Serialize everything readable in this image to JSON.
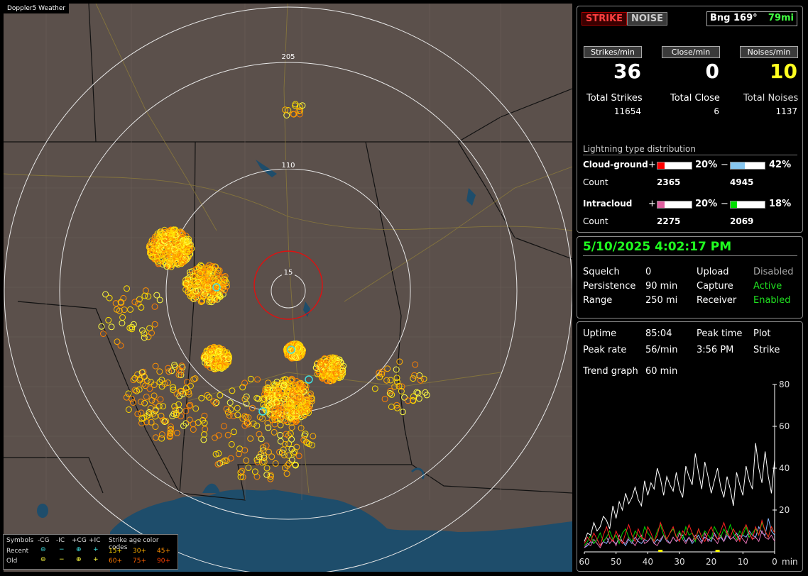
{
  "window_title": "Doppler5 Weather",
  "map": {
    "ring_labels": [
      "205",
      "110",
      "15"
    ],
    "legend": {
      "symbols_label": "Symbols",
      "cols": [
        "-CG",
        "-IC",
        "+CG",
        "+IC"
      ],
      "rows": [
        "Recent",
        "Old"
      ],
      "age_title": "Strike age color codes",
      "age_codes": [
        "15+",
        "30+",
        "45+",
        "60+",
        "75+",
        "90+"
      ],
      "age_colors": [
        "#ffd700",
        "#ffb000",
        "#ff9000",
        "#ff7a00",
        "#ff6000",
        "#ff4000"
      ]
    }
  },
  "status": {
    "strike_label": "STRIKE",
    "noise_label": "NOISE",
    "bearing": "Bng 169°",
    "distance": "79mi"
  },
  "rates": {
    "strikes_label": "Strikes/min",
    "close_label": "Close/min",
    "noises_label": "Noises/min",
    "strikes": "36",
    "close": "0",
    "noises": "10"
  },
  "totals": {
    "strikes_label": "Total Strikes",
    "close_label": "Total Close",
    "noises_label": "Total Noises",
    "strikes": "11654",
    "close": "6",
    "noises": "1137"
  },
  "distribution": {
    "title": "Lightning type distribution",
    "cg_label": "Cloud-ground",
    "ic_label": "Intracloud",
    "count_label": "Count",
    "plus": "+",
    "minus": "−",
    "cg_pos_pct": "20%",
    "cg_neg_pct": "42%",
    "cg_pos_count": "2365",
    "cg_neg_count": "4945",
    "ic_pos_pct": "20%",
    "ic_neg_pct": "18%",
    "ic_pos_count": "2275",
    "ic_neg_count": "2069",
    "colors": {
      "cg_pos": "#ff0000",
      "cg_neg": "#87c7f0",
      "ic_pos": "#e060a0",
      "ic_neg": "#00e000"
    }
  },
  "datetime": "5/10/2025 4:02:17 PM",
  "settings": {
    "squelch_label": "Squelch",
    "squelch": "0",
    "persistence_label": "Persistence",
    "persistence": "90 min",
    "range_label": "Range",
    "range": "250 mi",
    "upload_label": "Upload",
    "upload": "Disabled",
    "capture_label": "Capture",
    "capture": "Active",
    "receiver_label": "Receiver",
    "receiver": "Enabled"
  },
  "stats": {
    "uptime_label": "Uptime",
    "uptime": "85:04",
    "peak_time_label": "Peak time",
    "peak_time": "3:56 PM",
    "plot_label": "Plot",
    "plot": "Strike",
    "peak_rate_label": "Peak rate",
    "peak_rate": "56/min",
    "trend_label": "Trend graph",
    "trend": "60 min"
  },
  "chart_data": {
    "type": "line",
    "xlabel": "min",
    "x_ticks": [
      "60",
      "50",
      "40",
      "30",
      "20",
      "10",
      "0"
    ],
    "y_ticks": [
      "80",
      "60",
      "40",
      "20"
    ],
    "ylim": [
      0,
      80
    ],
    "xlim": [
      60,
      0
    ],
    "series": [
      {
        "color": "#ffffff",
        "values": [
          5,
          9,
          8,
          14,
          10,
          12,
          17,
          15,
          11,
          22,
          16,
          24,
          20,
          28,
          23,
          26,
          31,
          25,
          22,
          34,
          27,
          33,
          30,
          40,
          35,
          27,
          36,
          32,
          29,
          38,
          30,
          26,
          41,
          36,
          32,
          47,
          38,
          30,
          43,
          36,
          28,
          34,
          40,
          31,
          26,
          36,
          30,
          22,
          38,
          32,
          27,
          41,
          34,
          30,
          52,
          40,
          33,
          48,
          36,
          28,
          44
        ]
      },
      {
        "color": "#ff2020",
        "values": [
          4,
          7,
          5,
          9,
          6,
          3,
          8,
          12,
          7,
          5,
          10,
          6,
          4,
          9,
          13,
          8,
          5,
          11,
          7,
          6,
          12,
          9,
          5,
          8,
          14,
          10,
          6,
          9,
          12,
          7,
          5,
          10,
          8,
          13,
          9,
          6,
          11,
          7,
          5,
          9,
          12,
          8,
          6,
          10,
          14,
          9,
          7,
          11,
          8,
          5,
          10,
          13,
          9,
          6,
          12,
          8,
          15,
          10,
          7,
          12,
          9
        ]
      },
      {
        "color": "#00d000",
        "values": [
          3,
          5,
          8,
          4,
          6,
          9,
          5,
          7,
          10,
          6,
          8,
          4,
          9,
          11,
          7,
          5,
          10,
          8,
          6,
          12,
          9,
          7,
          5,
          10,
          13,
          8,
          6,
          9,
          11,
          7,
          10,
          6,
          12,
          8,
          9,
          5,
          11,
          7,
          10,
          8,
          6,
          12,
          9,
          7,
          11,
          8,
          13,
          9,
          6,
          10,
          8,
          12,
          7,
          9,
          11,
          8,
          14,
          10,
          7,
          12,
          9
        ]
      },
      {
        "color": "#e070b0",
        "values": [
          2,
          4,
          3,
          6,
          4,
          2,
          5,
          7,
          4,
          6,
          3,
          8,
          5,
          4,
          7,
          5,
          3,
          6,
          8,
          4,
          5,
          7,
          4,
          3,
          6,
          8,
          5,
          4,
          7,
          5,
          9,
          6,
          4,
          7,
          5,
          8,
          6,
          4,
          9,
          5,
          7,
          6,
          4,
          8,
          5,
          10,
          6,
          7,
          5,
          8,
          6,
          4,
          9,
          6,
          7,
          5,
          10,
          7,
          6,
          8,
          5
        ]
      },
      {
        "color": "#8ab8ff",
        "values": [
          2,
          3,
          5,
          4,
          6,
          3,
          5,
          4,
          7,
          5,
          4,
          6,
          5,
          3,
          6,
          4,
          7,
          5,
          4,
          6,
          5,
          7,
          4,
          6,
          5,
          8,
          6,
          4,
          7,
          5,
          6,
          8,
          5,
          7,
          4,
          6,
          8,
          5,
          7,
          6,
          5,
          9,
          6,
          7,
          5,
          8,
          6,
          7,
          9,
          6,
          8,
          7,
          10,
          8,
          7,
          12,
          9,
          8,
          16,
          10,
          8
        ]
      }
    ],
    "markers": [
      {
        "x": 36,
        "y": 0,
        "color": "#ffff00"
      },
      {
        "x": 18,
        "y": 0,
        "color": "#ffff00"
      }
    ]
  }
}
